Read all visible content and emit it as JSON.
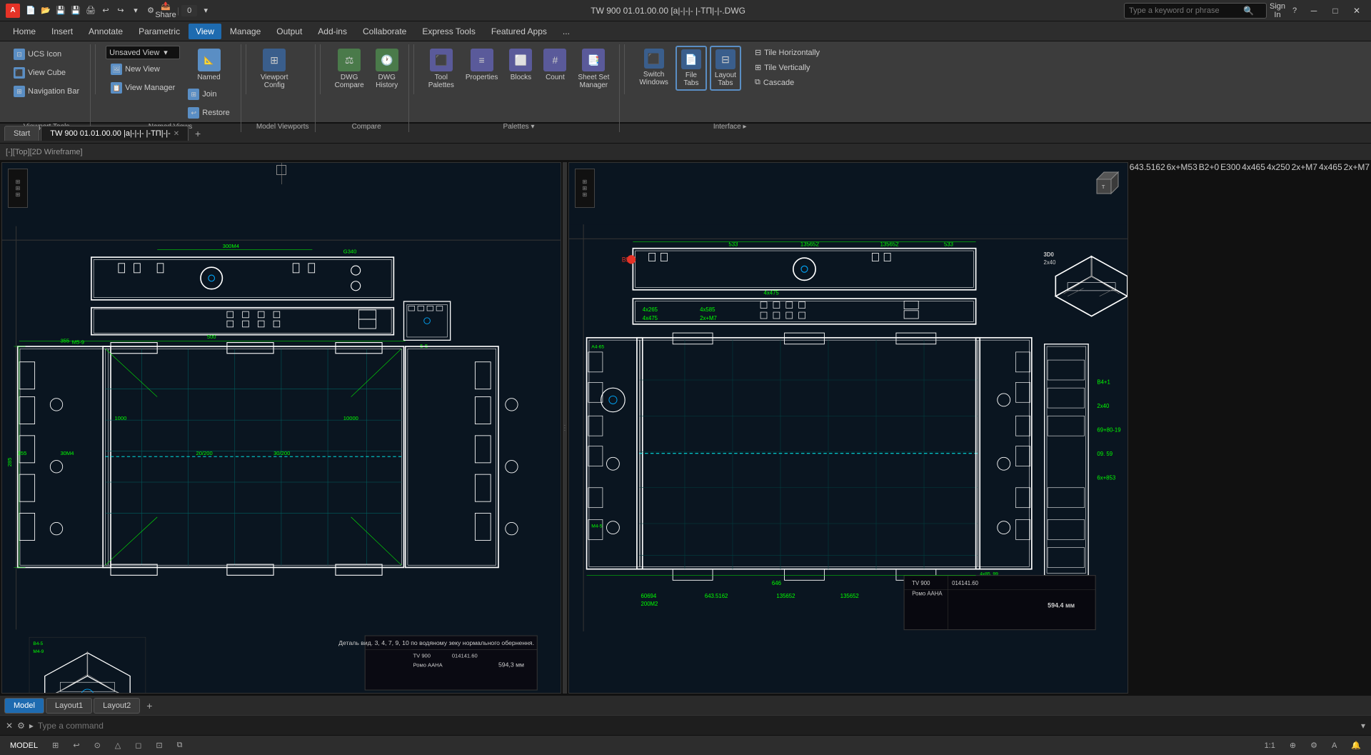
{
  "titlebar": {
    "app_name": "A",
    "title": "TW 900 01.01.00.00 [а|-|-|- |-ТП|-|-.DWG",
    "search_placeholder": "Type a keyword or phrase",
    "sign_in": "Sign In",
    "window_controls": [
      "─",
      "□",
      "✕"
    ]
  },
  "menubar": {
    "items": [
      "Home",
      "Insert",
      "Annotate",
      "Parametric",
      "View",
      "Manage",
      "Output",
      "Add-ins",
      "Collaborate",
      "Express Tools",
      "Featured Apps",
      "..."
    ]
  },
  "ribbon": {
    "active_tab": "View",
    "groups": [
      {
        "label": "",
        "buttons": [
          {
            "id": "ucs-icon",
            "label": "UCS\nIcon"
          },
          {
            "id": "view-cube",
            "label": "View\nCube"
          },
          {
            "id": "navigation-bar",
            "label": "Navigation\nBar"
          }
        ]
      },
      {
        "label": "Named Views",
        "dropdown": "Unsaved View",
        "sub_buttons": [
          "New View",
          "View Manager"
        ],
        "named_btn": "Named",
        "join_btn": "Join",
        "restore_btn": "Restore"
      },
      {
        "label": "Model Viewports",
        "buttons": [
          "Viewport\nConfiguration",
          "DWG\nCompare",
          "DWG\nHistory"
        ],
        "sub": [
          "Tool\nPalettes",
          "Properties",
          "Blocks",
          "Count",
          "Sheet Set\nManager"
        ]
      },
      {
        "label": "Compare",
        "items": [
          "DWG\nCompare",
          "DWG\nHistory"
        ]
      },
      {
        "label": "Palettes",
        "items": [
          "Tool\nPalettes",
          "Properties",
          "Blocks",
          "Count",
          "Sheet Set\nManager"
        ]
      },
      {
        "label": "Interface",
        "buttons": [
          "Switch\nWindows",
          "File\nTabs",
          "Layout\nTabs"
        ],
        "tiles": [
          "Tile Horizontally",
          "Tile Vertically",
          "Cascade"
        ]
      }
    ]
  },
  "viewport_header": {
    "label": "[-][Top][2D Wireframe]"
  },
  "doc_tabs": [
    {
      "label": "Start",
      "active": false
    },
    {
      "label": "TW 900 01.01.00.00 |а|-|-|- |-ТП|-|-",
      "active": true
    }
  ],
  "layout_tabs": [
    {
      "label": "Model",
      "active": true
    },
    {
      "label": "Layout1",
      "active": false
    },
    {
      "label": "Layout2",
      "active": false
    }
  ],
  "command_line": {
    "placeholder": "Type a command"
  },
  "status_bar": {
    "model_label": "MODEL",
    "items": [
      "⊞",
      "↩",
      "⊙",
      "△",
      "◻",
      "⊡",
      "⧉",
      "1:1",
      "⊕"
    ]
  }
}
